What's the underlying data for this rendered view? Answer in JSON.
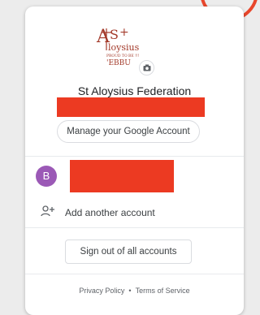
{
  "org": {
    "logo_main": "ASt",
    "logo_word": "Aloysius",
    "logo_tagline": "PROUD TO BE !!!",
    "logo_sub": "'EBBU",
    "name": "St Aloysius Federation"
  },
  "manage_account_label": "Manage your Google Account",
  "account": {
    "avatar_initial": "B"
  },
  "add_account_label": "Add another account",
  "sign_out_label": "Sign out of all accounts",
  "footer": {
    "privacy_label": "Privacy Policy",
    "separator": "•",
    "terms_label": "Terms of Service"
  },
  "colors": {
    "accent_ring": "#e8472c",
    "redaction": "#ec3a22",
    "avatar": "#9b59b6",
    "logo": "#a33a2a"
  },
  "icons": [
    "camera-icon",
    "add-person-icon"
  ]
}
